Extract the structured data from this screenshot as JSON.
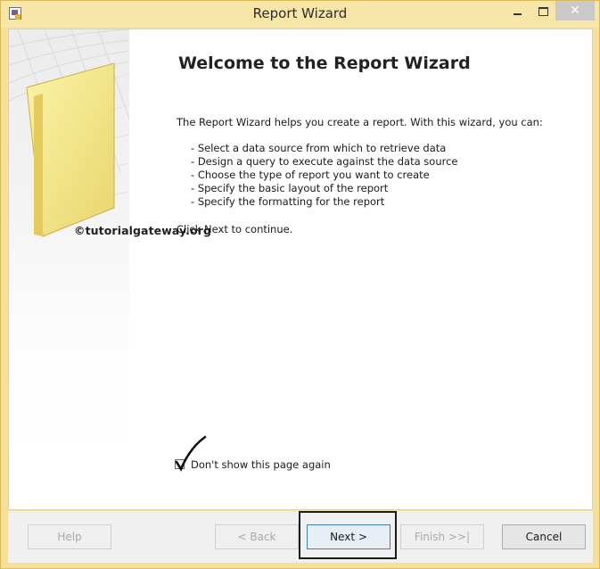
{
  "window": {
    "title": "Report Wizard",
    "close_glyph": "✕",
    "accent_color": "#f6df97",
    "icons": {
      "app": "report-wizard-icon",
      "minimize": "minimize-icon",
      "maximize": "maximize-icon",
      "close": "close-icon"
    }
  },
  "side_panel": {
    "watermark": "©tutorialgateway.org"
  },
  "main": {
    "heading": "Welcome to the Report Wizard",
    "intro": "The Report Wizard helps you create a report. With this wizard, you can:",
    "bullets": [
      "Select a data source from which to retrieve data",
      "Design a query to execute against the data source",
      "Choose the type of report you want to create",
      "Specify the basic layout of the report",
      "Specify the formatting for the report"
    ],
    "continue_text": "Click Next to continue."
  },
  "option": {
    "label": "Don't show this page again",
    "checked": true
  },
  "buttons": {
    "help": "Help",
    "back": "< Back",
    "next": "Next >",
    "finish": "Finish >>|",
    "cancel": "Cancel"
  }
}
